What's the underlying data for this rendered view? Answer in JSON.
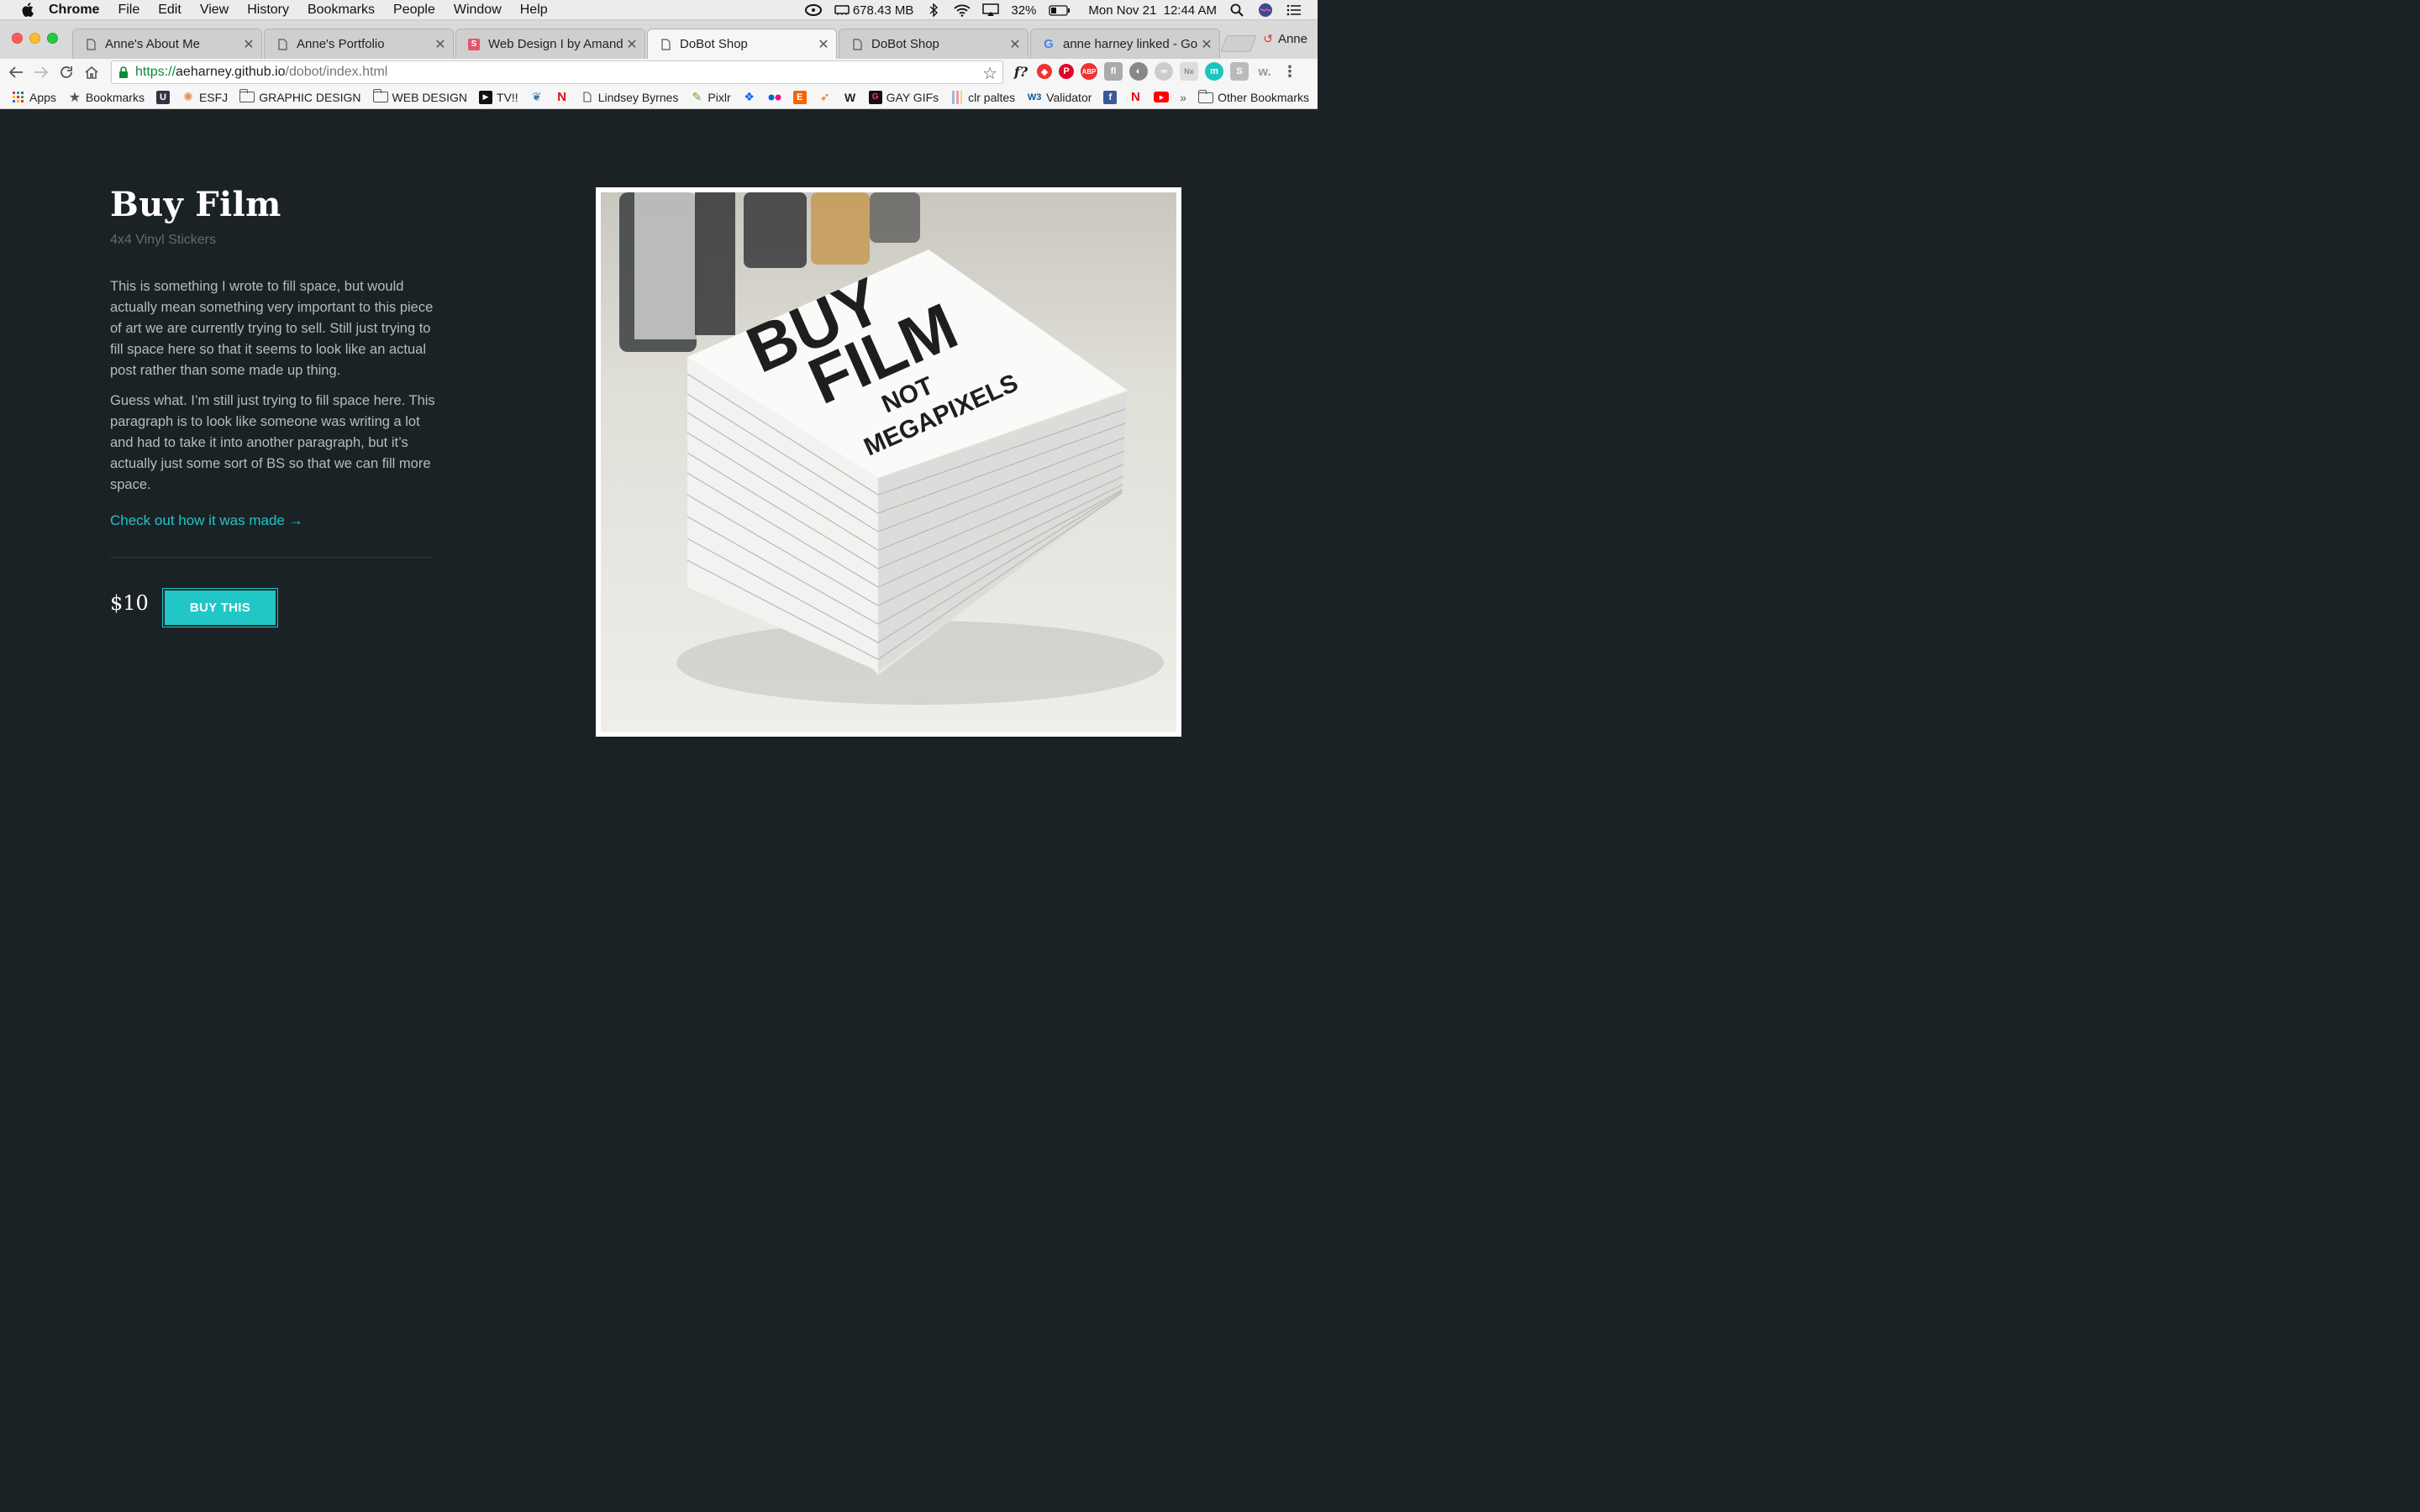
{
  "menubar": {
    "app_name": "Chrome",
    "menus": [
      "File",
      "Edit",
      "View",
      "History",
      "Bookmarks",
      "People",
      "Window",
      "Help"
    ],
    "memory": "678.43 MB",
    "battery": "32%",
    "datetime": "Mon Nov 21  12:44 AM"
  },
  "tabs": [
    {
      "label": "Anne's About Me",
      "active": false
    },
    {
      "label": "Anne's Portfolio",
      "active": false
    },
    {
      "label": "Web Design I by Amanda C",
      "active": false
    },
    {
      "label": "DoBot Shop",
      "active": true
    },
    {
      "label": "DoBot Shop",
      "active": false
    },
    {
      "label": "anne harney linked - Googl",
      "active": false
    }
  ],
  "profile_name": "Anne",
  "address": {
    "scheme": "https://",
    "host": "aeharney.github.io",
    "path": "/dobot/index.html"
  },
  "bookmarks": [
    {
      "label": "Apps"
    },
    {
      "label": "Bookmarks"
    },
    {
      "label": "ESFJ"
    },
    {
      "label": "GRAPHIC DESIGN"
    },
    {
      "label": "WEB DESIGN"
    },
    {
      "label": "TV!!"
    },
    {
      "label": "Lindsey Byrnes"
    },
    {
      "label": "Pixlr"
    },
    {
      "label": "GAY GIFs"
    },
    {
      "label": "clr paltes"
    },
    {
      "label": "Validator"
    }
  ],
  "other_bookmarks": "Other Bookmarks",
  "product": {
    "title": "Buy Film",
    "subtitle": "4x4 Vinyl Stickers",
    "paragraph1": "This is something I wrote to fill space, but would actually mean something very important to this piece of art we are currently trying to sell. Still just trying to fill space here so that it seems to look like an actual post rather than some made up thing.",
    "paragraph2": "Guess what. I’m still just trying to fill space here. This paragraph is to look like someone was writing a lot and had to take it into another paragraph, but it’s actually just some sort of BS so that we can fill more space.",
    "made_link": "Check out how it was made →",
    "price": "$10",
    "buy_label": "BUY THIS",
    "sticker_line1": "BUY",
    "sticker_line2": "FILM",
    "sticker_line3": "NOT",
    "sticker_line4": "MEGAPIXELS"
  },
  "colors": {
    "page_bg": "#1b2226",
    "accent": "#22c6c6"
  }
}
